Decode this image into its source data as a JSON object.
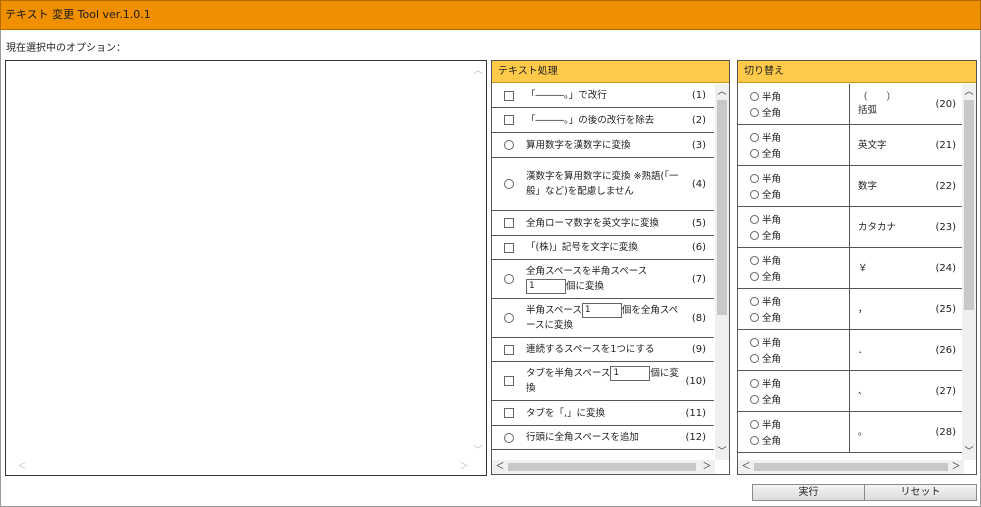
{
  "app": {
    "title": "テキスト 変更 Tool ver.1.0.1"
  },
  "options_label": "現在選択中のオプション：",
  "text_processing": {
    "title": "テキスト処理",
    "items": [
      {
        "control": "checkbox",
        "label": "「―――。」で改行",
        "num": "(1)"
      },
      {
        "control": "checkbox",
        "label": "「―――。」の後の改行を除去",
        "num": "(2)"
      },
      {
        "control": "radio",
        "label": "算用数字を漢数字に変換",
        "num": "(3)"
      },
      {
        "control": "radio",
        "label": "漢数字を算用数字に変換 ※熟語(「一般」など)を配慮しません",
        "num": "(4)"
      },
      {
        "control": "checkbox",
        "label": "全角ローマ数字を英文字に変換",
        "num": "(5)"
      },
      {
        "control": "checkbox",
        "label": "「(株)」記号を文字に変換",
        "num": "(6)"
      },
      {
        "control": "radio",
        "label_before": "全角スペースを半角スペース",
        "input": "1",
        "label_after": "個に変換",
        "num": "(7)"
      },
      {
        "control": "radio",
        "label_before": "半角スペース",
        "input": "1",
        "label_after": "個を全角スペースに変換",
        "num": "(8)"
      },
      {
        "control": "checkbox",
        "label": "連続するスペースを1つにする",
        "num": "(9)"
      },
      {
        "control": "checkbox",
        "label_before": "タブを半角スペース",
        "input": "1",
        "label_after": "個に変換",
        "num": "(10)"
      },
      {
        "control": "checkbox",
        "label": "タブを「,」に変換",
        "num": "(11)"
      },
      {
        "control": "radio",
        "label": "行頭に全角スペースを追加",
        "num": "(12)"
      }
    ]
  },
  "switching": {
    "title": "切り替え",
    "half_label": "半角",
    "full_label": "全角",
    "items": [
      {
        "label": "（　　）\n括弧",
        "num": "(20)"
      },
      {
        "label": "英文字",
        "num": "(21)"
      },
      {
        "label": "数字",
        "num": "(22)"
      },
      {
        "label": "カタカナ",
        "num": "(23)"
      },
      {
        "label": "￥",
        "num": "(24)"
      },
      {
        "label": "，",
        "num": "(25)"
      },
      {
        "label": "．",
        "num": "(26)"
      },
      {
        "label": "、",
        "num": "(27)"
      },
      {
        "label": "。",
        "num": "(28)"
      }
    ]
  },
  "buttons": {
    "execute": "実行",
    "reset": "リセット"
  }
}
